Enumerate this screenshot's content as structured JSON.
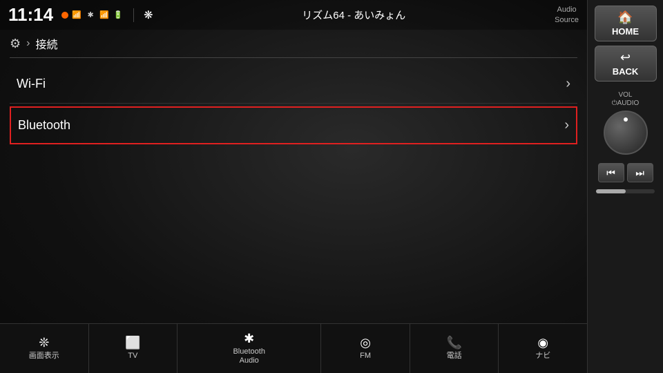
{
  "status": {
    "time": "11:14",
    "now_playing": "リズム64 - あいみょん",
    "audio_source_line1": "Audio",
    "audio_source_line2": "Source"
  },
  "breadcrumb": {
    "gear_symbol": "⚙",
    "separator": "›",
    "label": "接続"
  },
  "menu": {
    "items": [
      {
        "label": "Wi-Fi",
        "highlighted": false
      },
      {
        "label": "Bluetooth",
        "highlighted": true
      }
    ]
  },
  "bottom_bar": {
    "items": [
      {
        "icon": "❉",
        "label": "画面表示",
        "extra": ""
      },
      {
        "icon": "🖥",
        "label": "TV",
        "extra": ""
      },
      {
        "icon": "Ⓑ",
        "label": "Bluetooth\nAudio",
        "extra": ""
      },
      {
        "icon": "◎",
        "label": "FM",
        "extra": ""
      },
      {
        "icon": "📞",
        "label": "電話",
        "extra": ""
      },
      {
        "icon": "◉",
        "label": "ナビ",
        "extra": ""
      }
    ]
  },
  "right_panel": {
    "home_label": "HOME",
    "back_label": "BACK",
    "vol_label_line1": "VOL",
    "vol_label_line2": "⏻AUDIO"
  }
}
